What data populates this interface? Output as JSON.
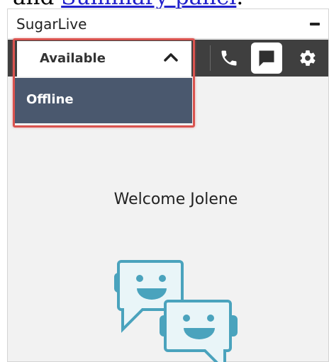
{
  "page": {
    "prefix_text": "and ",
    "link_text": "Summary panel",
    "suffix_text": "."
  },
  "widget": {
    "title": "SugarLive",
    "minimize_icon": "minimize-icon"
  },
  "toolbar": {
    "phone_icon": "phone-icon",
    "chat_icon": "chat-icon",
    "settings_icon": "gear-icon",
    "active_tab": "chat"
  },
  "status": {
    "selected": "Available",
    "options": [
      "Offline"
    ],
    "expanded": true,
    "highlight_color": "#d9534f"
  },
  "main": {
    "welcome": "Welcome Jolene",
    "illustration": "chat-bubbles-icon"
  },
  "colors": {
    "toolbar_bg": "#3f3f3f",
    "option_bg": "#4a586e",
    "accent": "#4aa3bd"
  }
}
